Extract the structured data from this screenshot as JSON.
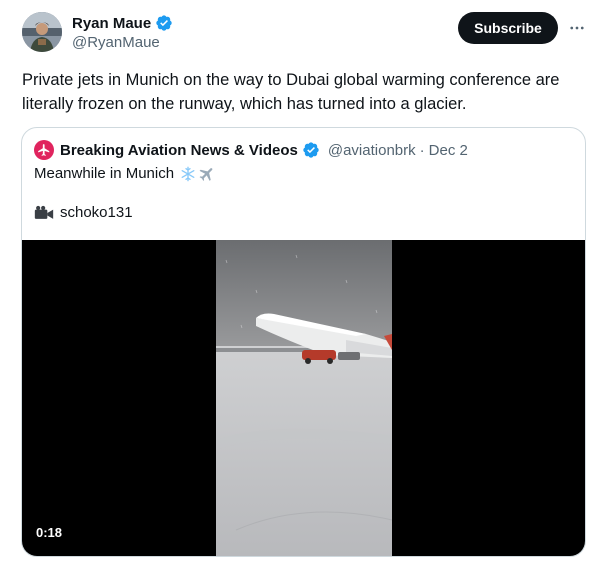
{
  "author": {
    "name": "Ryan Maue",
    "handle": "@RyanMaue",
    "verified_icon": "verified-badge-icon"
  },
  "actions": {
    "subscribe_label": "Subscribe",
    "more_icon": "more-horizontal-icon"
  },
  "tweet": {
    "text": "Private jets in Munich on the way to Dubai global warming conference are literally frozen on the runway, which has turned into a glacier."
  },
  "quoted_tweet": {
    "author_name": "Breaking Aviation News & Videos",
    "handle": "@aviationbrk",
    "separator": "·",
    "date": "Dec 2",
    "text": "Meanwhile in Munich",
    "emojis": [
      "snowflake-icon",
      "airplane-icon"
    ],
    "credit": "schoko131",
    "credit_icon": "video-camera-icon",
    "video": {
      "duration": "0:18"
    }
  },
  "colors": {
    "accent_blue": "#1d9bf0",
    "text_primary": "#0f1419",
    "text_secondary": "#536471",
    "border": "#cfd9de",
    "brand_red": "#e0245e"
  }
}
